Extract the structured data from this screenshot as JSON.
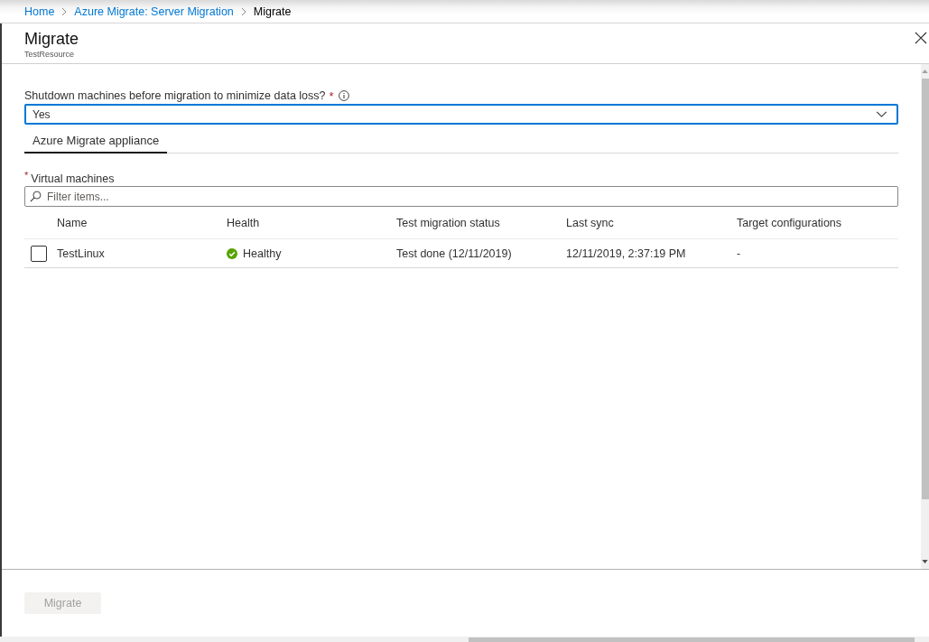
{
  "breadcrumbs": [
    {
      "label": "Home",
      "current": false
    },
    {
      "label": "Azure Migrate: Server Migration",
      "current": false
    },
    {
      "label": "Migrate",
      "current": true
    }
  ],
  "panel": {
    "title": "Migrate",
    "subtitle": "TestResource"
  },
  "shutdown_field": {
    "label": "Shutdown machines before migration to minimize data loss?",
    "required_mark": "*",
    "value": "Yes"
  },
  "tabs": [
    {
      "label": "Azure Migrate appliance",
      "selected": true
    }
  ],
  "virtual_machines": {
    "required_mark": "*",
    "label": "Virtual machines",
    "filter": {
      "placeholder": "Filter items..."
    },
    "columns": [
      "Name",
      "Health",
      "Test migration status",
      "Last sync",
      "Target configurations"
    ],
    "rows": [
      {
        "checked": false,
        "name": "TestLinux",
        "health": "Healthy",
        "test_migration_status": "Test done (12/11/2019)",
        "last_sync": "12/11/2019, 2:37:19 PM",
        "target_configurations": "-"
      }
    ]
  },
  "footer": {
    "buttons": [
      {
        "label": "Migrate",
        "disabled": true
      }
    ]
  }
}
